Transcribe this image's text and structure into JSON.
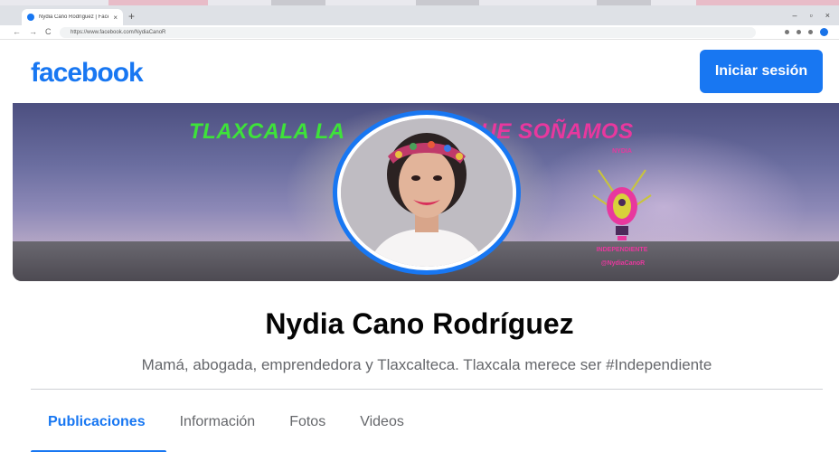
{
  "browser": {
    "tab_title": "Nydia Cano Rodríguez | Facebook",
    "tab_close": "×",
    "new_tab": "+",
    "url": "https://www.facebook.com/NydiaCanoR",
    "nav_back": "←",
    "nav_forward": "→",
    "nav_reload": "C",
    "win_min": "–",
    "win_max": "▫",
    "win_close": "×"
  },
  "header": {
    "logo_text": "facebook",
    "login_label": "Iniciar sesión"
  },
  "cover": {
    "slogan_green": "TLAXCALA LA",
    "slogan_pink": "UE SOÑAMOS",
    "badge_top": "NYDIA",
    "badge_bottom": "INDEPENDIENTE",
    "badge_social": "@NydiaCanoR"
  },
  "profile": {
    "name": "Nydia Cano Rodríguez",
    "bio": "Mamá, abogada, emprendedora y Tlaxcalteca. Tlaxcala merece ser #Independiente"
  },
  "tabs": [
    {
      "label": "Publicaciones"
    },
    {
      "label": "Información"
    },
    {
      "label": "Fotos"
    },
    {
      "label": "Videos"
    }
  ],
  "colors": {
    "brand": "#1877f2",
    "slogan_green": "#3ee23a",
    "slogan_pink": "#e8389e"
  },
  "icons": [
    "facebook-favicon",
    "back-arrow-icon",
    "forward-arrow-icon",
    "reload-icon",
    "profile-avatar",
    "lightbulb-logo-icon"
  ]
}
